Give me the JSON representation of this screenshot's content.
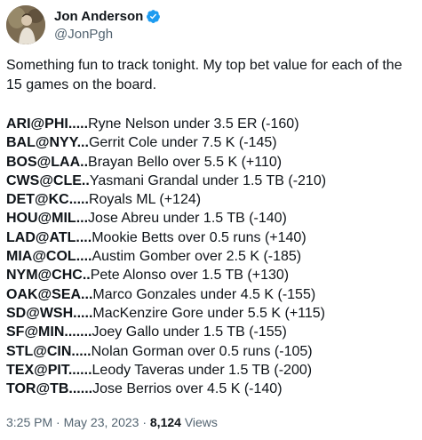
{
  "author": {
    "display_name": "Jon Anderson",
    "handle": "@JonPgh",
    "verified_icon": "verified-badge-icon",
    "verified_color": "#1d9bf0"
  },
  "tweet": {
    "intro": "Something fun to track tonight. My top bet value for each of the 15 games on the board.",
    "bets": [
      {
        "game": "ARI@PHI.....",
        "bet": "Ryne Nelson under 3.5 ER (-160)"
      },
      {
        "game": "BAL@NYY...",
        "bet": "Gerrit Cole under 7.5 K (-145)"
      },
      {
        "game": "BOS@LAA..",
        "bet": "Brayan Bello over 5.5 K (+110)"
      },
      {
        "game": "CWS@CLE..",
        "bet": "Yasmani Grandal under 1.5 TB (-210)"
      },
      {
        "game": "DET@KC.....",
        "bet": "Royals ML (+124)"
      },
      {
        "game": "HOU@MIL...",
        "bet": "Jose Abreu under 1.5 TB (-140)"
      },
      {
        "game": "LAD@ATL....",
        "bet": "Mookie Betts over 0.5 runs (+140)"
      },
      {
        "game": "MIA@COL....",
        "bet": "Austim Gomber over 2.5 K (-185)"
      },
      {
        "game": "NYM@CHC..",
        "bet": "Pete Alonso over 1.5 TB (+130)"
      },
      {
        "game": "OAK@SEA...",
        "bet": "Marco Gonzales under 4.5 K (-155)"
      },
      {
        "game": "SD@WSH.....",
        "bet": "MacKenzire Gore under 5.5 K (+115)"
      },
      {
        "game": "SF@MIN.......",
        "bet": "Joey Gallo under 1.5 TB (-155)"
      },
      {
        "game": "STL@CIN.....",
        "bet": "Nolan Gorman over 0.5 runs (-105)"
      },
      {
        "game": "TEX@PIT......",
        "bet": "Leody Taveras under 1.5 TB (-200)"
      },
      {
        "game": "TOR@TB......",
        "bet": "Jose Berrios over 4.5 K (-140)"
      }
    ]
  },
  "meta": {
    "time": "3:25 PM",
    "separator": " · ",
    "date": "May 23, 2023",
    "views_count": "8,124",
    "views_label": " Views"
  }
}
